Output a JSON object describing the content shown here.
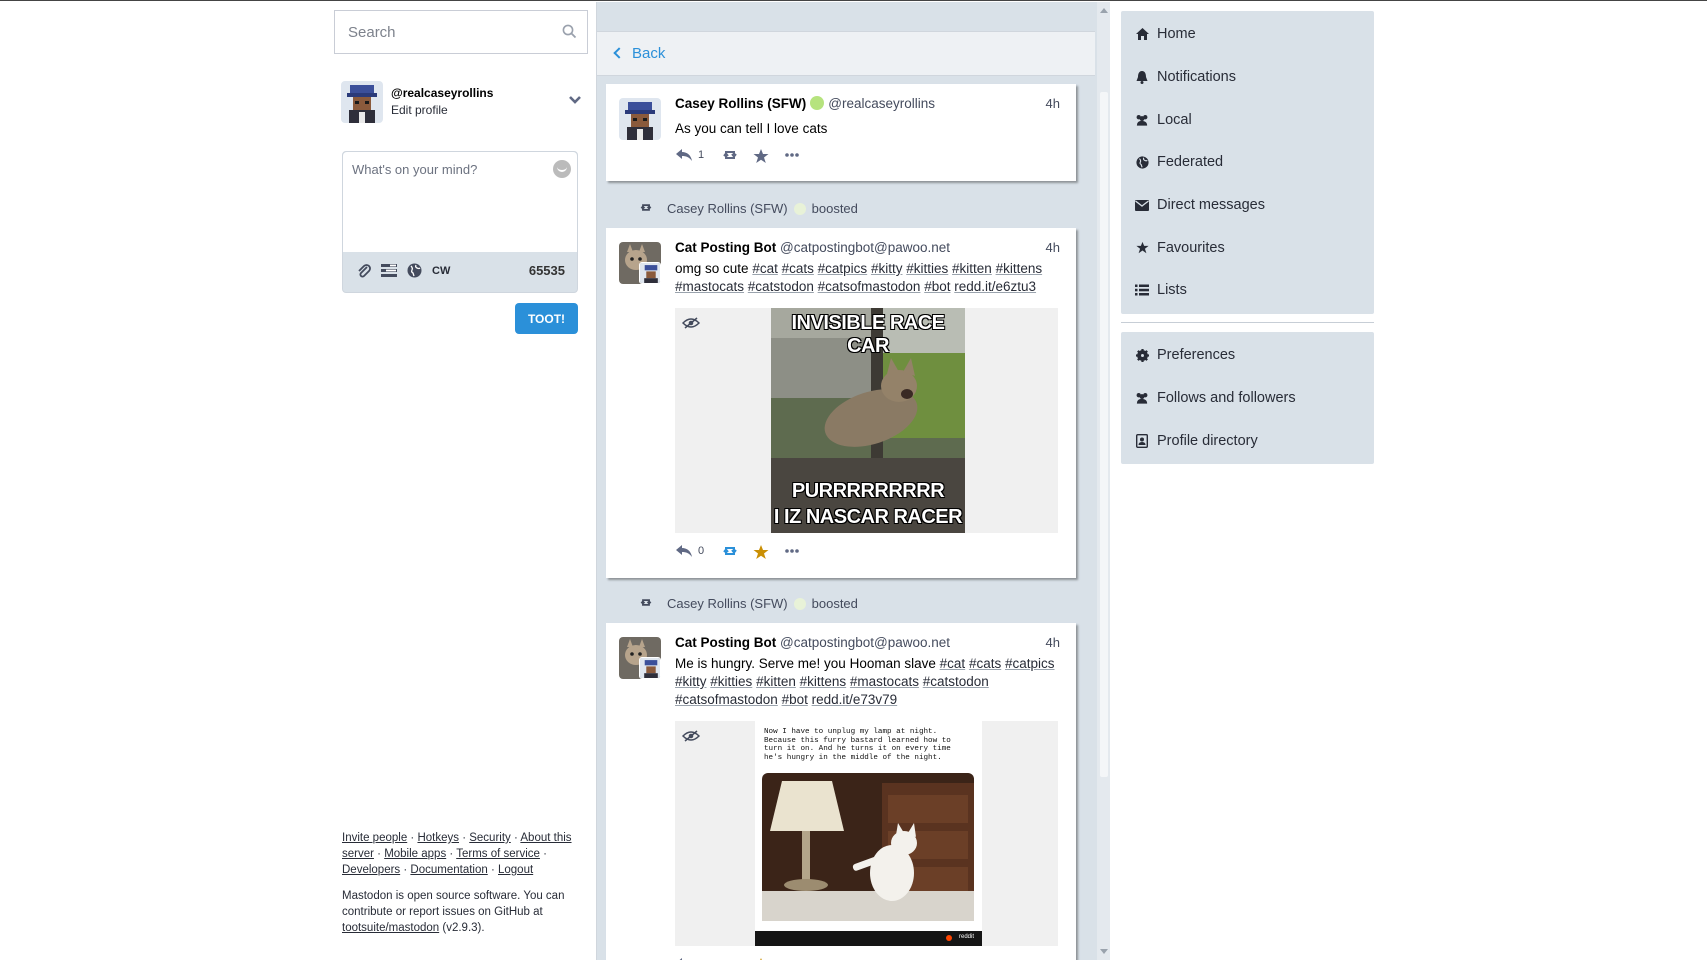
{
  "search": {
    "placeholder": "Search"
  },
  "account": {
    "handle": "@realcaseyrollins",
    "edit_label": "Edit profile"
  },
  "compose": {
    "placeholder": "What's on your mind?",
    "cw_label": "CW",
    "char_count": "65535",
    "submit_label": "TOOT!"
  },
  "footer": {
    "links": [
      "Invite people",
      "Hotkeys",
      "Security",
      "About this server",
      "Mobile apps",
      "Terms of service",
      "Developers",
      "Documentation",
      "Logout"
    ],
    "about_pre": "Mastodon is open source software. You can contribute or report issues on GitHub at ",
    "repo_link": "tootsuite/mastodon",
    "version": "(v2.9.3)."
  },
  "timeline": {
    "back_label": "Back",
    "statuses": [
      {
        "display_name": "Casey Rollins (SFW)",
        "username": "@realcaseyrollins",
        "time": "4h",
        "text": "As you can tell I love cats",
        "reply_count": "1",
        "favourited": false
      },
      {
        "boosted_by": "Casey Rollins (SFW)",
        "boosted_label": "boosted",
        "display_name": "Cat Posting Bot",
        "username": "@catpostingbot@pawoo.net",
        "time": "4h",
        "text_prefix": "omg so cute",
        "tags": [
          "#cat",
          "#cats",
          "#catpics",
          "#kitty",
          "#kitties",
          "#kitten",
          "#kittens",
          "#mastocats",
          "#catstodon",
          "#catsofmastodon",
          "#bot"
        ],
        "link": "redd.it/e6ztu3",
        "media_caption_top": "INVISIBLE RACE CAR",
        "media_caption_bottom_1": "PURRRRRRRRR",
        "media_caption_bottom_2": "I IZ NASCAR RACER",
        "reply_count": "0",
        "favourited": true
      },
      {
        "boosted_by": "Casey Rollins (SFW)",
        "boosted_label": "boosted",
        "display_name": "Cat Posting Bot",
        "username": "@catpostingbot@pawoo.net",
        "time": "4h",
        "text_prefix": "Me is hungry. Serve me! you Hooman slave",
        "tags": [
          "#cat",
          "#cats",
          "#catpics",
          "#kitty",
          "#kitties",
          "#kitten",
          "#kittens",
          "#mastocats",
          "#catstodon",
          "#catsofmastodon",
          "#bot"
        ],
        "link": "redd.it/e73v79",
        "media_text": "Now I have to unplug my lamp at night. Because this furry bastard learned how to turn it on. And he turns it on every time he's hungry in the middle of the night.",
        "media_watermark": "reddit",
        "favourited": true
      }
    ]
  },
  "nav": {
    "main": [
      {
        "label": "Home",
        "icon": "home-icon"
      },
      {
        "label": "Notifications",
        "icon": "bell-icon"
      },
      {
        "label": "Local",
        "icon": "users-icon"
      },
      {
        "label": "Federated",
        "icon": "globe-icon"
      },
      {
        "label": "Direct messages",
        "icon": "envelope-icon"
      },
      {
        "label": "Favourites",
        "icon": "star-icon"
      },
      {
        "label": "Lists",
        "icon": "list-icon"
      }
    ],
    "settings": [
      {
        "label": "Preferences",
        "icon": "gear-icon"
      },
      {
        "label": "Follows and followers",
        "icon": "users-icon"
      },
      {
        "label": "Profile directory",
        "icon": "address-book-icon"
      }
    ]
  },
  "colors": {
    "accent": "#2b90d9",
    "column_bg": "#d9e1e8",
    "favourite": "#ca8f04",
    "verified": "#b6e37e"
  }
}
